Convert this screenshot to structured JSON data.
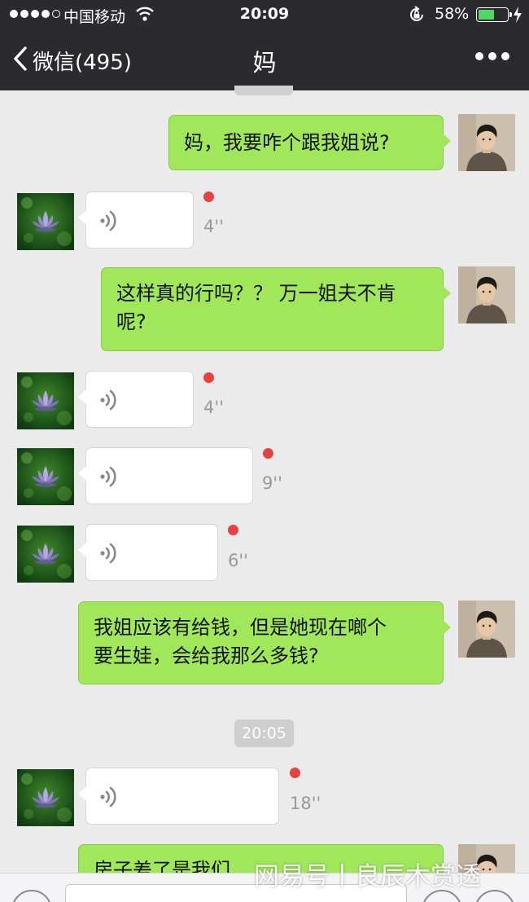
{
  "status_bar": {
    "carrier": "中国移动",
    "time": "20:09",
    "battery_percent": "58%",
    "battery_level": 0.58,
    "icons": [
      "signal-dots-icon",
      "wifi-icon",
      "rotation-lock-icon",
      "battery-icon",
      "charging-icon"
    ]
  },
  "nav": {
    "back_label": "微信(495)",
    "title": "妈",
    "icons": [
      "chevron-left-icon",
      "more-dots-icon"
    ]
  },
  "messages": [
    {
      "side": "out",
      "text": "妈，我要咋个跟我姐说?"
    },
    {
      "side": "in",
      "type": "voice",
      "duration": "4''",
      "unread": true
    },
    {
      "side": "out",
      "text": "这样真的行吗？？ 万一姐夫不肯\n呢?"
    },
    {
      "side": "in",
      "type": "voice",
      "duration": "4''",
      "unread": true
    },
    {
      "side": "in",
      "type": "voice",
      "duration": "9''",
      "unread": true
    },
    {
      "side": "in",
      "type": "voice",
      "duration": "6''",
      "unread": true
    },
    {
      "side": "out",
      "text": "我姐应该有给钱，但是她现在啷个\n要生娃，会给我那么多钱?"
    },
    {
      "side": "time",
      "text": "20:05"
    },
    {
      "side": "in",
      "type": "voice",
      "duration": "18''",
      "unread": true
    },
    {
      "side": "out",
      "text": "房子差了是我们..."
    }
  ],
  "watermark": "网易号丨良辰木赏透",
  "colors": {
    "bar": "#2b2a2f",
    "background": "#ebebeb",
    "out_bubble": "#a0e75a",
    "in_bubble": "#ffffff",
    "unread_dot": "#e64340",
    "battery_fill": "#4cd964"
  }
}
